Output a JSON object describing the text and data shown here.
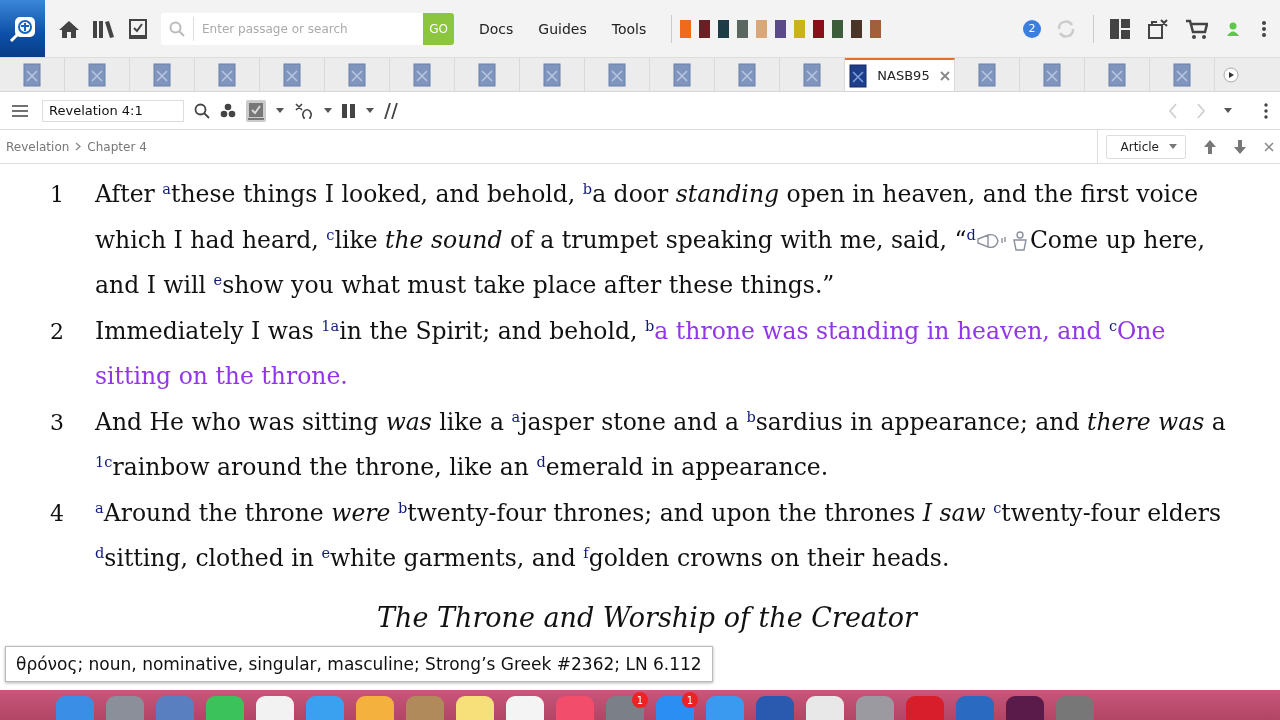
{
  "toolbar": {
    "search": {
      "placeholder": "Enter passage or search"
    },
    "go": "GO",
    "menus": [
      "Docs",
      "Guides",
      "Tools"
    ],
    "books": [
      {
        "color": "#f06a1e"
      },
      {
        "color": "#6b1e24"
      },
      {
        "color": "#1d3c45"
      },
      {
        "color": "#5a6660"
      },
      {
        "color": "#d9a77a"
      },
      {
        "color": "#5b4a8a"
      },
      {
        "color": "#c9b21a"
      },
      {
        "color": "#8a0f1a"
      },
      {
        "color": "#3d5c3a"
      },
      {
        "color": "#4a3526"
      },
      {
        "color": "#a0603a"
      }
    ],
    "notifications": "2"
  },
  "tabs": [
    {
      "selected": false
    },
    {
      "selected": false
    },
    {
      "selected": false
    },
    {
      "selected": false
    },
    {
      "selected": false
    },
    {
      "selected": false
    },
    {
      "selected": false
    },
    {
      "selected": false
    },
    {
      "selected": false
    },
    {
      "selected": false
    },
    {
      "selected": false
    },
    {
      "selected": false
    },
    {
      "selected": false
    },
    {
      "label": "NASB95",
      "selected": true
    },
    {
      "selected": false
    },
    {
      "selected": false
    },
    {
      "selected": false
    },
    {
      "selected": false
    }
  ],
  "panel": {
    "reference": "Revelation 4:1",
    "breadcrumb": [
      "Revelation",
      "Chapter 4"
    ],
    "view": "Article"
  },
  "verses": [
    {
      "number": "1",
      "segments": [
        {
          "kind": "text",
          "text": "After $^{a}$these things I looked, and behold, $^{b}$a door *standing* open in heaven, and the first voice which I had heard, $^{c}$like *the sound* of a trumpet speaking with me, said, “$^{d}$",
          "highlighted": false
        },
        {
          "kind": "media"
        },
        {
          "kind": "text",
          "text": "Come up here, and I will $^{e}$show you what must take place after these things.”",
          "highlighted": false
        }
      ]
    },
    {
      "number": "2",
      "segments": [
        {
          "kind": "text",
          "text": "Immediately I was $^{1a}$in the Spirit; and behold, $^{b}$",
          "highlighted": false
        },
        {
          "kind": "text",
          "text": "a throne was standing in heaven, and $^{c}$One sitting on the throne.",
          "highlighted": true
        }
      ]
    },
    {
      "number": "3",
      "segments": [
        {
          "kind": "text",
          "text": "And He who was sitting *was* like a $^{a}$jasper stone and a $^{b}$sardius in appearance; and *there was* a $^{1c}$rainbow around the throne, like an $^{d}$emerald in appearance.",
          "highlighted": false
        }
      ]
    },
    {
      "number": "4",
      "segments": [
        {
          "kind": "text",
          "text": "$^{a}$Around the throne *were* $^{b}$twenty-four thrones; and upon the thrones *I saw* $^{c}$twenty-four elders $^{d}$sitting, clothed in $^{e}$white garments, and $^{f}$golden crowns on their heads.",
          "highlighted": false
        }
      ]
    }
  ],
  "heading": "The Throne and Worship of the Creator",
  "tooltip": "θρόνος; noun, nominative, singular, masculine; Strong’s Greek #2362; LN 6.112",
  "dock": [
    {
      "color": "#3a8ee6"
    },
    {
      "color": "#8a8f99"
    },
    {
      "color": "#5a7fc0"
    },
    {
      "color": "#3cc25a"
    },
    {
      "color": "#f2f2f2"
    },
    {
      "color": "#3aa0f0"
    },
    {
      "color": "#f5b13d"
    },
    {
      "color": "#b08a5a"
    },
    {
      "color": "#f7e07a"
    },
    {
      "color": "#f4f4f4"
    },
    {
      "color": "#f24d6a"
    },
    {
      "color": "#7a7f88",
      "badge": "1"
    },
    {
      "color": "#2a8ef2",
      "badge": "1"
    },
    {
      "color": "#3a9af0"
    },
    {
      "color": "#2a5ab0"
    },
    {
      "color": "#e8e8e8"
    },
    {
      "color": "#9a9aa0"
    },
    {
      "color": "#d81e2a"
    },
    {
      "color": "#2a6ac0"
    },
    {
      "color": "#5a1a4a"
    },
    {
      "color": "#777777"
    }
  ]
}
